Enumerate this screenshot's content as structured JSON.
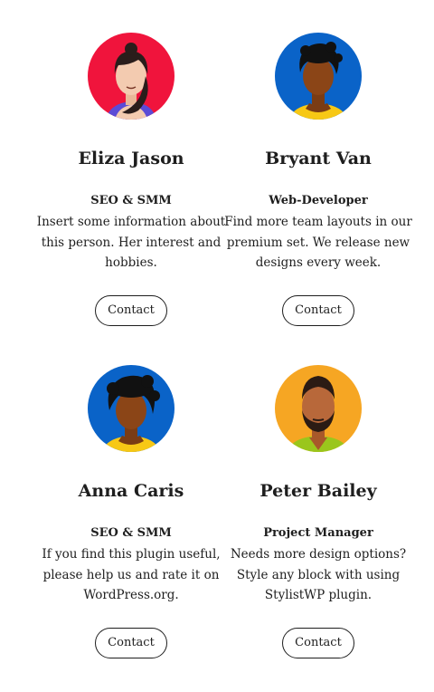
{
  "members": [
    {
      "name": "Eliza Jason",
      "role": "SEO & SMM",
      "bio": "Insert some information about this person. Her interest and hobbies.",
      "contact_label": "Contact",
      "avatar_bg": "#f0143c",
      "avatar_icon": "woman-avatar-icon"
    },
    {
      "name": "Bryant Van",
      "role": "Web-Developer",
      "bio": "Find more team layouts in our premium set. We release new designs every week.",
      "contact_label": "Contact",
      "avatar_bg": "#0a63c8",
      "avatar_icon": "man-curly-avatar-icon"
    },
    {
      "name": "Anna Caris",
      "role": "SEO & SMM",
      "bio": "If you find this plugin useful, please help us and rate it on WordPress.org.",
      "contact_label": "Contact",
      "avatar_bg": "#0a63c8",
      "avatar_icon": "woman-curly-avatar-icon"
    },
    {
      "name": "Peter Bailey",
      "role": "Project Manager",
      "bio": "Needs more design options? Style any block with using StylistWP plugin.",
      "contact_label": "Contact",
      "avatar_bg": "#f6a623",
      "avatar_icon": "man-beard-avatar-icon"
    }
  ]
}
